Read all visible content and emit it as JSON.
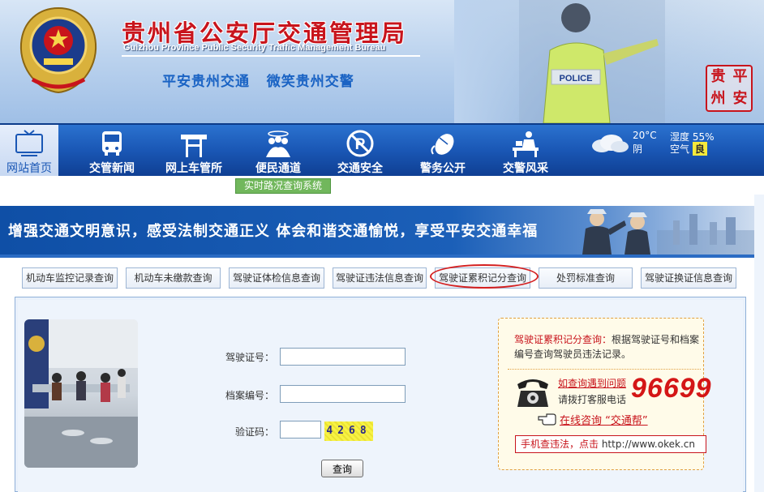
{
  "header": {
    "title_cn": "贵州省公安厅交通管理局",
    "title_en": "Guizhou Province Public Security Traffic Management Bureau",
    "slogan": "平安贵州交通   微笑贵州交警",
    "police_label": "POLICE",
    "seal_chars": [
      "贵",
      "平",
      "州",
      "安"
    ],
    "emblem": "police-emblem-icon",
    "colors": {
      "title_red": "#c8141c",
      "nav_blue": "#1a57b5",
      "slogan_blue": "#1a63c4"
    }
  },
  "nav": {
    "items": [
      {
        "label": "网站首页",
        "icon": "tv-icon"
      },
      {
        "label": "交管新闻",
        "icon": "bus-icon"
      },
      {
        "label": "网上车管所",
        "icon": "signpost-icon"
      },
      {
        "label": "便民通道",
        "icon": "people-icon"
      },
      {
        "label": "交通安全",
        "icon": "no-parking-icon"
      },
      {
        "label": "警务公开",
        "icon": "mouse-icon"
      },
      {
        "label": "交警风采",
        "icon": "officer-desk-icon"
      }
    ],
    "sub_tab": "实时路况查询系统"
  },
  "weather": {
    "temp": "20°C",
    "cond": "阴",
    "hum_label": "湿度",
    "hum_value": "55%",
    "air_label": "空气",
    "air_value": "良"
  },
  "banner": {
    "text": "增强交通文明意识，感受法制交通正义   体会和谐交通愉悦，享受平安交通幸福"
  },
  "query_tabs": [
    "机动车监控记录查询",
    "机动车未缴款查询",
    "驾驶证体检信息查询",
    "驾驶证违法信息查询",
    "驾驶证累积记分查询",
    "处罚标准查询",
    "驾驶证换证信息查询"
  ],
  "active_tab": "驾驶证累积记分查询",
  "form": {
    "license_label": "驾驶证号：",
    "license_value": "",
    "file_label": "档案编号：",
    "file_value": "",
    "captcha_label": "验证码：",
    "captcha_value": "",
    "captcha_text": "4268",
    "submit": "查询"
  },
  "info": {
    "title": "驾驶证累积记分查询：",
    "desc": "根据驾驶证号和档案编号查询驾驶员违法记录。",
    "help_q": "如查询遇到问题",
    "help_call": "请拨打客服电话",
    "hotline": "96699",
    "online": "在线咨询 “交通帮”",
    "mobile_prefix": "手机查违法，点击 ",
    "mobile_url": "http://www.okek.cn"
  }
}
